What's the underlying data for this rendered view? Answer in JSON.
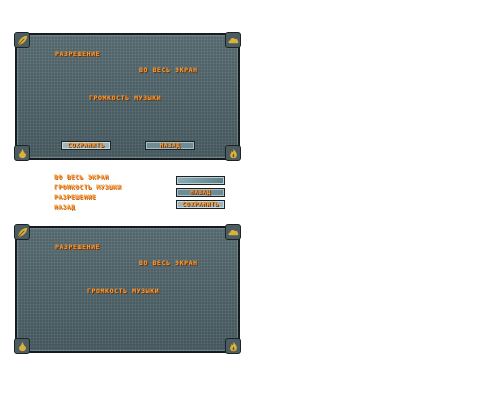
{
  "settings_panel": {
    "resolution_label": "РАЗРЕШЕНИЕ",
    "fullscreen_label": "ВО ВЕСЬ ЭКРАН",
    "music_volume_label": "ГРОМКОСТЬ МУЗЫКИ",
    "save_button": "СОХРАНИТЬ",
    "back_button": "НАЗАД"
  },
  "sprite_sheet": {
    "labels": [
      "ВО ВЕСЬ ЭКРАН",
      "ГРОМКОСТЬ МУЗЫКИ",
      "РАЗРЕШЕНИЕ",
      "НАЗАД"
    ],
    "buttons": [
      "",
      "НАЗАД",
      "СОХРАНИТЬ"
    ]
  },
  "icons": {
    "top_left": "leaf-icon",
    "top_right": "cloud-icon",
    "bottom_left": "pear-icon",
    "bottom_right": "flame-icon"
  },
  "colors": {
    "text_orange": "#ff9a2e",
    "panel_slate": "#4f6369",
    "icon_gold": "#d9b13b"
  }
}
